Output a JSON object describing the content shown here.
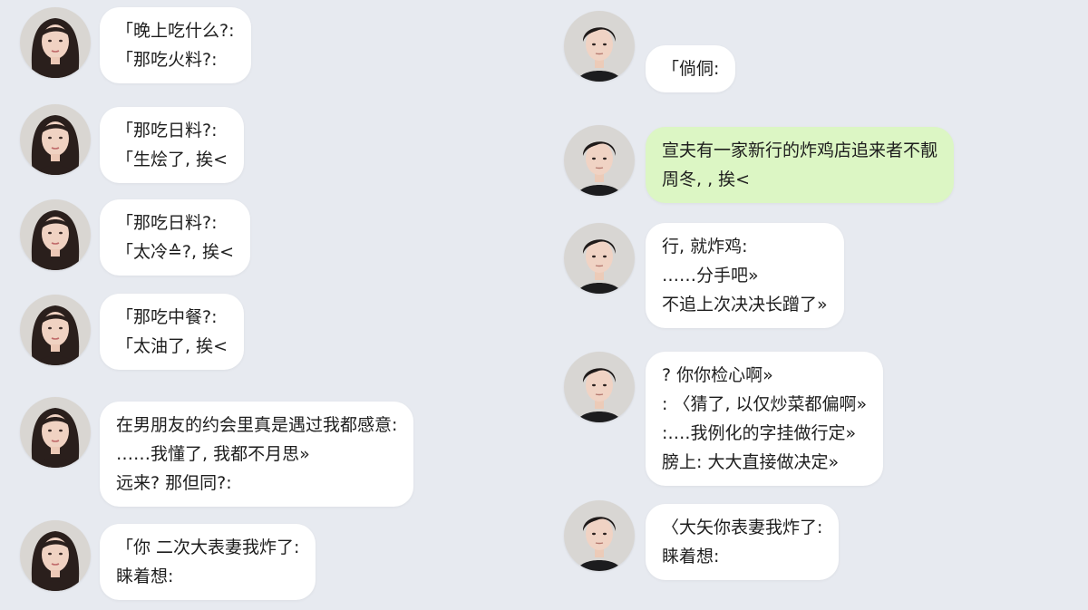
{
  "colors": {
    "background": "#e7eaf0",
    "bubble": "#ffffff",
    "bubble_highlight": "#dcf6c4"
  },
  "left_messages": [
    {
      "lines": [
        "「晚上吃什么?:",
        "「那吃火料?:"
      ]
    },
    {
      "lines": [
        "「那吃日料?:",
        "「生烩了, 挨<"
      ]
    },
    {
      "lines": [
        "「那吃日料?:",
        "「太冷≙?, 挨<"
      ]
    },
    {
      "lines": [
        "「那吃中餐?:",
        "「太油了, 挨<"
      ]
    },
    {
      "lines": [
        "在男朋友的约会里真是遇过我都感意:",
        "……我懂了, 我都不月思»",
        "远来? 那但同?:"
      ]
    },
    {
      "lines": [
        "「你 二次大表妻我炸了:",
        "睐着想:"
      ]
    }
  ],
  "right_messages": [
    {
      "lines": [
        "「倘侗:"
      ]
    },
    {
      "lines": [
        "宣夫有一家新行的炸鸡店追来者不靓",
        "周冬, , 挨<"
      ],
      "highlight": true
    },
    {
      "lines": [
        "行, 就炸鸡:",
        "……分手吧»",
        "不追上次决决长蹭了»"
      ]
    },
    {
      "lines": [
        "? 你你检心啊»",
        ": 〈猜了, 以仅炒菜都偏啊»",
        ":….我例化的字挂做行定»",
        "膀上:    大大直接做决定»"
      ]
    },
    {
      "lines": [
        "〈大矢你表妻我炸了:",
        "睐着想:"
      ]
    }
  ]
}
